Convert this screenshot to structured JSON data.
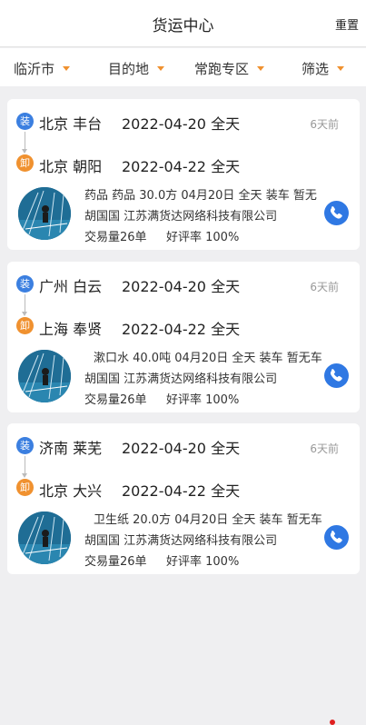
{
  "header": {
    "title": "货运中心",
    "reset_label": "重置"
  },
  "filters": [
    {
      "label": "临沂市"
    },
    {
      "label": "目的地"
    },
    {
      "label": "常跑专区"
    },
    {
      "label": "筛选"
    }
  ],
  "icons": {
    "load_badge": "装",
    "unload_badge": "卸",
    "phone": "phone-icon",
    "dropdown": "triangle-down-icon"
  },
  "colors": {
    "accent": "#f0912f",
    "load": "#3b7fe0",
    "phone": "#2f78e3"
  },
  "orders": [
    {
      "from_city": "北京 丰台",
      "from_date": "2022-04-20 全天",
      "to_city": "北京 朝阳",
      "to_date": "2022-04-22 全天",
      "time_ago": "6天前",
      "cargo": "药品  药品  30.0方  04月20日  全天 装车  暂无",
      "contact": "胡国国    江苏满货达网络科技有限公司",
      "trades": "交易量26单",
      "rating": "好评率  100%"
    },
    {
      "from_city": "广州 白云",
      "from_date": "2022-04-20 全天",
      "to_city": "上海 奉贤",
      "to_date": "2022-04-22 全天",
      "time_ago": "6天前",
      "cargo": "漱口水  40.0吨  04月20日  全天 装车  暂无车",
      "contact": "胡国国    江苏满货达网络科技有限公司",
      "trades": "交易量26单",
      "rating": "好评率  100%"
    },
    {
      "from_city": "济南 莱芜",
      "from_date": "2022-04-20 全天",
      "to_city": "北京 大兴",
      "to_date": "2022-04-22 全天",
      "time_ago": "6天前",
      "cargo": "卫生纸  20.0方  04月20日  全天 装车  暂无车",
      "contact": "胡国国    江苏满货达网络科技有限公司",
      "trades": "交易量26单",
      "rating": "好评率  100%"
    }
  ]
}
